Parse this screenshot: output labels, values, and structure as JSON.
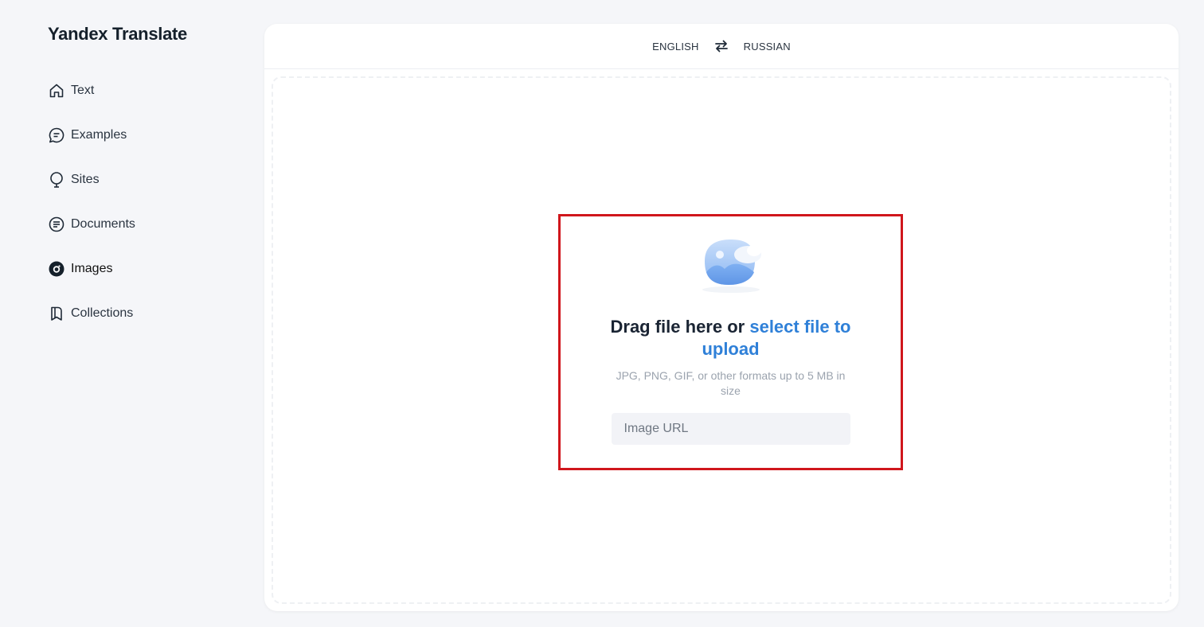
{
  "app": {
    "title": "Yandex Translate"
  },
  "sidebar": {
    "items": [
      {
        "label": "Text",
        "icon": "home-icon",
        "active": false
      },
      {
        "label": "Examples",
        "icon": "chat-bubble-icon",
        "active": false
      },
      {
        "label": "Sites",
        "icon": "globe-pin-icon",
        "active": false
      },
      {
        "label": "Documents",
        "icon": "document-icon",
        "active": false
      },
      {
        "label": "Images",
        "icon": "camera-icon",
        "active": true
      },
      {
        "label": "Collections",
        "icon": "bookmark-icon",
        "active": false
      }
    ]
  },
  "languages": {
    "source": "ENGLISH",
    "target": "RUSSIAN",
    "swap_icon": "swap-arrows-icon"
  },
  "upload": {
    "icon": "image-placeholder-icon",
    "headline_prefix": "Drag file here or ",
    "headline_link": "select file to upload",
    "hint": "JPG, PNG, GIF, or other formats up to 5 MB in size",
    "url_placeholder": "Image URL",
    "url_value": ""
  },
  "colors": {
    "accent": "#2f80d8",
    "highlight": "#d0161c",
    "background": "#f5f6f9"
  }
}
